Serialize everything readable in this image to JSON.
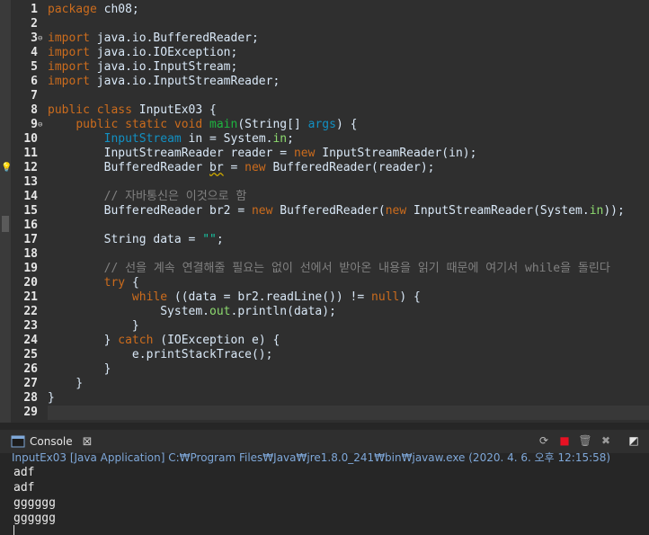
{
  "editor": {
    "line_numbers": [
      "1",
      "2",
      "3",
      "4",
      "5",
      "6",
      "7",
      "8",
      "9",
      "10",
      "11",
      "12",
      "13",
      "14",
      "15",
      "16",
      "17",
      "18",
      "19",
      "20",
      "21",
      "22",
      "23",
      "24",
      "25",
      "26",
      "27",
      "28",
      "29"
    ],
    "fold_markers": [
      {
        "line": 3,
        "glyph": "⊖"
      },
      {
        "line": 9,
        "glyph": "⊖"
      }
    ],
    "bulb_line": 12,
    "lines": [
      [
        [
          "kw",
          "package "
        ],
        [
          "pl",
          "ch08;"
        ]
      ],
      [],
      [
        [
          "kw",
          "import "
        ],
        [
          "pl",
          "java.io.BufferedReader;"
        ]
      ],
      [
        [
          "kw",
          "import "
        ],
        [
          "pl",
          "java.io.IOException;"
        ]
      ],
      [
        [
          "kw",
          "import "
        ],
        [
          "pl",
          "java.io.InputStream;"
        ]
      ],
      [
        [
          "kw",
          "import "
        ],
        [
          "pl",
          "java.io.InputStreamReader;"
        ]
      ],
      [],
      [
        [
          "kw",
          "public class "
        ],
        [
          "pl",
          "InputEx03 {"
        ]
      ],
      [
        [
          "pl",
          "    "
        ],
        [
          "kw",
          "public static void "
        ],
        [
          "mt",
          "main"
        ],
        [
          "pl",
          "(String[] "
        ],
        [
          "ty",
          "args"
        ],
        [
          "pl",
          ") {"
        ]
      ],
      [
        [
          "pl",
          "        "
        ],
        [
          "ty",
          "InputStream "
        ],
        [
          "pl",
          "in = System."
        ],
        [
          "fd",
          "in"
        ],
        [
          "pl",
          ";"
        ]
      ],
      [
        [
          "pl",
          "        InputStreamReader reader = "
        ],
        [
          "kw",
          "new "
        ],
        [
          "pl",
          "InputStreamReader(in);"
        ]
      ],
      [
        [
          "pl",
          "        BufferedReader "
        ],
        [
          "warn",
          "br"
        ],
        [
          "pl",
          " = "
        ],
        [
          "kw",
          "new "
        ],
        [
          "pl",
          "BufferedReader(reader);"
        ]
      ],
      [],
      [
        [
          "pl",
          "        "
        ],
        [
          "cm",
          "// 자바통신은 이것으로 함"
        ]
      ],
      [
        [
          "pl",
          "        BufferedReader br2 = "
        ],
        [
          "kw",
          "new "
        ],
        [
          "pl",
          "BufferedReader("
        ],
        [
          "kw",
          "new "
        ],
        [
          "pl",
          "InputStreamReader(System."
        ],
        [
          "fd",
          "in"
        ],
        [
          "pl",
          "));"
        ]
      ],
      [],
      [
        [
          "pl",
          "        String data = "
        ],
        [
          "st",
          "\"\""
        ],
        [
          "pl",
          ";"
        ]
      ],
      [],
      [
        [
          "pl",
          "        "
        ],
        [
          "cm",
          "// 선을 계속 연결해줄 필요는 없이 선에서 받아온 내용을 읽기 때문에 여기서 while을 돌린다"
        ]
      ],
      [
        [
          "pl",
          "        "
        ],
        [
          "kw",
          "try "
        ],
        [
          "pl",
          "{"
        ]
      ],
      [
        [
          "pl",
          "            "
        ],
        [
          "kw",
          "while "
        ],
        [
          "pl",
          "((data = br2.readLine()) != "
        ],
        [
          "kw",
          "null"
        ],
        [
          "pl",
          ") {"
        ]
      ],
      [
        [
          "pl",
          "                System."
        ],
        [
          "fd",
          "out"
        ],
        [
          "pl",
          ".println(data);"
        ]
      ],
      [
        [
          "pl",
          "            }"
        ]
      ],
      [
        [
          "pl",
          "        } "
        ],
        [
          "kw",
          "catch "
        ],
        [
          "pl",
          "(IOException e) {"
        ]
      ],
      [
        [
          "pl",
          "            e.printStackTrace();"
        ]
      ],
      [
        [
          "pl",
          "        }"
        ]
      ],
      [
        [
          "pl",
          "    }"
        ]
      ],
      [
        [
          "pl",
          "}"
        ]
      ],
      []
    ]
  },
  "console": {
    "tab_label": "Console",
    "tab_close_glyph": "⊠",
    "launch_info": "InputEx03 [Java Application] C:₩Program Files₩Java₩jre1.8.0_241₩bin₩javaw.exe (2020. 4. 6. 오후 12:15:58)",
    "output_lines": [
      "adf",
      "adf",
      "gggggg",
      "gggggg"
    ],
    "toolbar": [
      {
        "name": "refresh-icon",
        "glyph": "⟳",
        "color": "#b9b9b9"
      },
      {
        "name": "terminate-icon",
        "glyph": "■",
        "color": "#e81123"
      },
      {
        "name": "remove-launch-icon",
        "glyph": "🗑",
        "color": "#9a9a9a"
      },
      {
        "name": "remove-all-icon",
        "glyph": "✖",
        "color": "#9a9a9a"
      },
      {
        "name": "clear-console-icon",
        "glyph": "◩",
        "color": "#e6e6e6"
      }
    ]
  },
  "colors": {
    "keyword": "#cc6c1d",
    "type": "#1290c3",
    "field": "#8dda6f",
    "method": "#1eb540",
    "string": "#17c6a3",
    "comment": "#808080",
    "plain": "#d9e8f7"
  }
}
